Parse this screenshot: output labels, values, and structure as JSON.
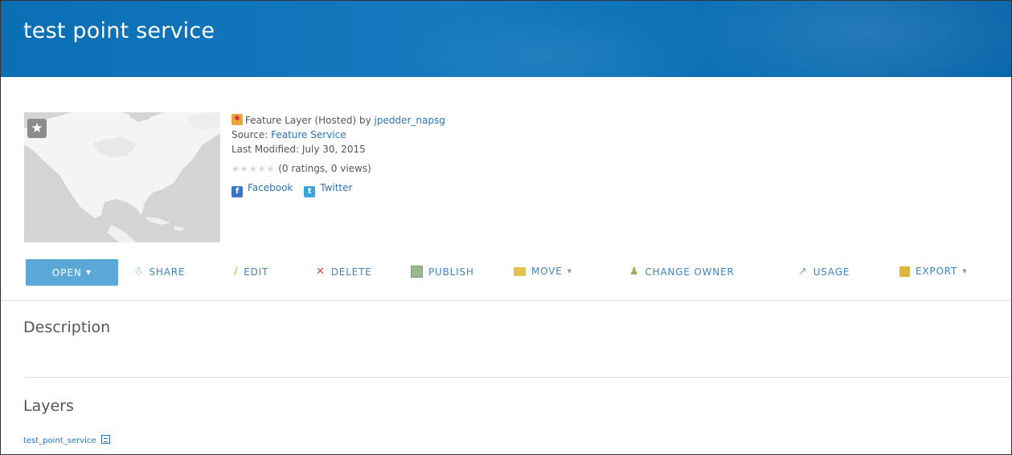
{
  "banner": {
    "title": "test point service"
  },
  "item": {
    "type_label": "Feature Layer (Hosted)",
    "by_text": "by",
    "owner": "jpedder_napsg",
    "source_label": "Source:",
    "source_value": "Feature Service",
    "modified_label": "Last Modified:",
    "modified_value": "July 30, 2015",
    "ratings_text": "(0 ratings, 0 views)",
    "facebook_label": "Facebook",
    "twitter_label": "Twitter",
    "stars_total": 5,
    "stars_filled": 0
  },
  "toolbar": {
    "open_label": "OPEN",
    "share_label": "SHARE",
    "edit_label": "EDIT",
    "delete_label": "DELETE",
    "publish_label": "PUBLISH",
    "move_label": "MOVE",
    "change_owner_label": "CHANGE OWNER",
    "usage_label": "USAGE",
    "export_label": "EXPORT"
  },
  "sections": {
    "description_title": "Description",
    "layers_title": "Layers"
  },
  "layers": [
    {
      "name": "test_point_service"
    }
  ],
  "colors": {
    "banner": "#0e71b6",
    "link": "#2a74b8",
    "action": "#3b86c4",
    "open_button": "#5aa8d8",
    "delete_x": "#d9473f"
  }
}
